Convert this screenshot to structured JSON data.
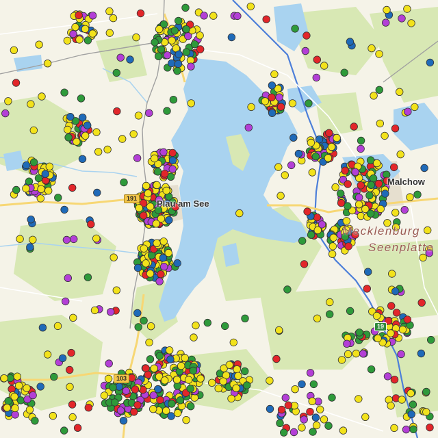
{
  "map": {
    "labels": {
      "town_west": "Plau am See",
      "town_east": "Malchow",
      "region_line1": "Mecklenburg",
      "region_line2": "Seenplatte"
    },
    "road_shields": {
      "b191": "191",
      "b103": "103",
      "a19": "19"
    },
    "marker_colors": {
      "yellow": "#f2e21b",
      "green": "#2e9a3a",
      "red": "#e2262a",
      "blue": "#1f6ab8",
      "purple": "#b33fd6"
    },
    "water_color": "#a9d3f0",
    "land_color": "#f5f3e8",
    "forest_color": "#d8e8b4"
  }
}
